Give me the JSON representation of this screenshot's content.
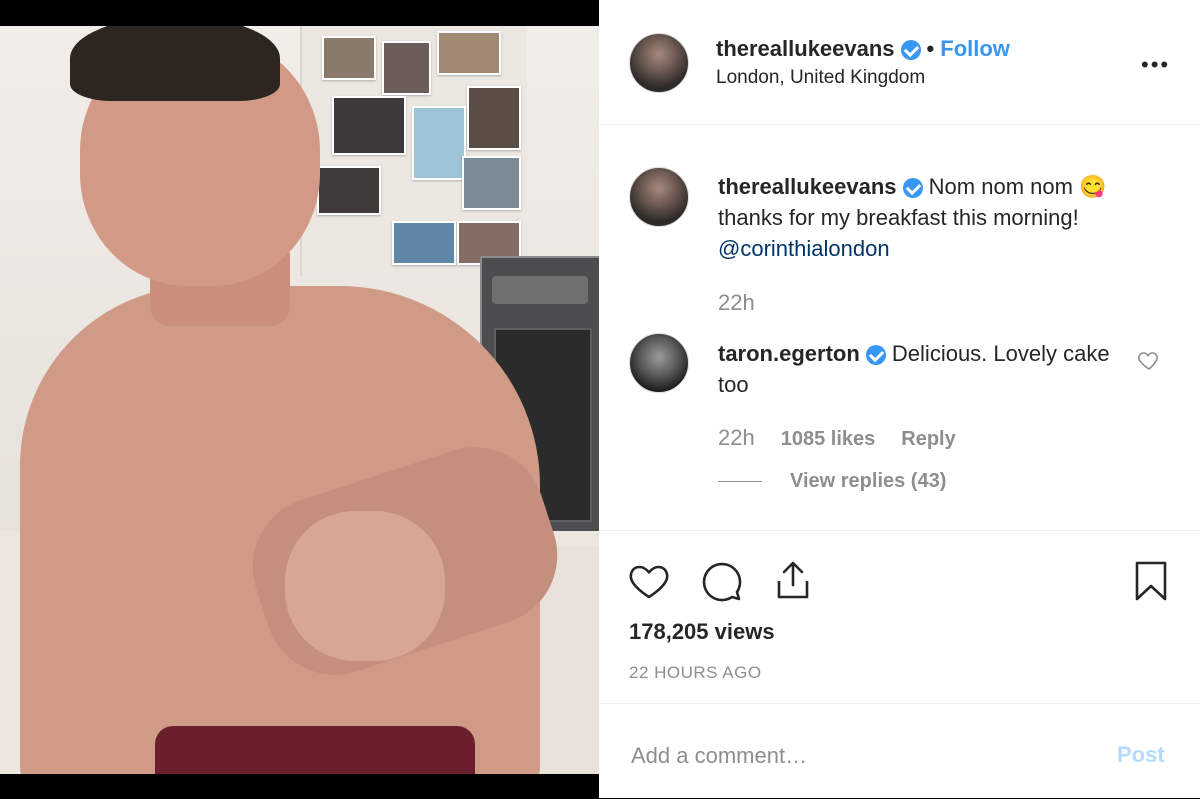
{
  "post": {
    "username": "thereallukeevans",
    "follow_label": "Follow",
    "separator": "•",
    "location": "London, United Kingdom",
    "more_icon": "more-options-icon"
  },
  "caption": {
    "username": "thereallukeevans",
    "text": "Nom nom nom 😋 thanks for my breakfast this morning!",
    "mention": "@corinthialondon",
    "time": "22h"
  },
  "comment": {
    "username": "taron.egerton",
    "text": "Delicious. Lovely cake too",
    "time": "22h",
    "likes": "1085 likes",
    "reply_label": "Reply",
    "view_replies": "View replies (43)"
  },
  "stats": {
    "views": "178,205 views",
    "ago": "22 HOURS AGO"
  },
  "comment_box": {
    "placeholder": "Add a comment…",
    "post_label": "Post"
  },
  "colors": {
    "accent": "#3897f0",
    "muted": "#8e8e8e",
    "mention": "#003569",
    "post_disabled": "#b3dbff"
  },
  "icons": [
    "heart-icon",
    "comment-icon",
    "share-icon",
    "bookmark-icon",
    "verified-badge-icon"
  ]
}
